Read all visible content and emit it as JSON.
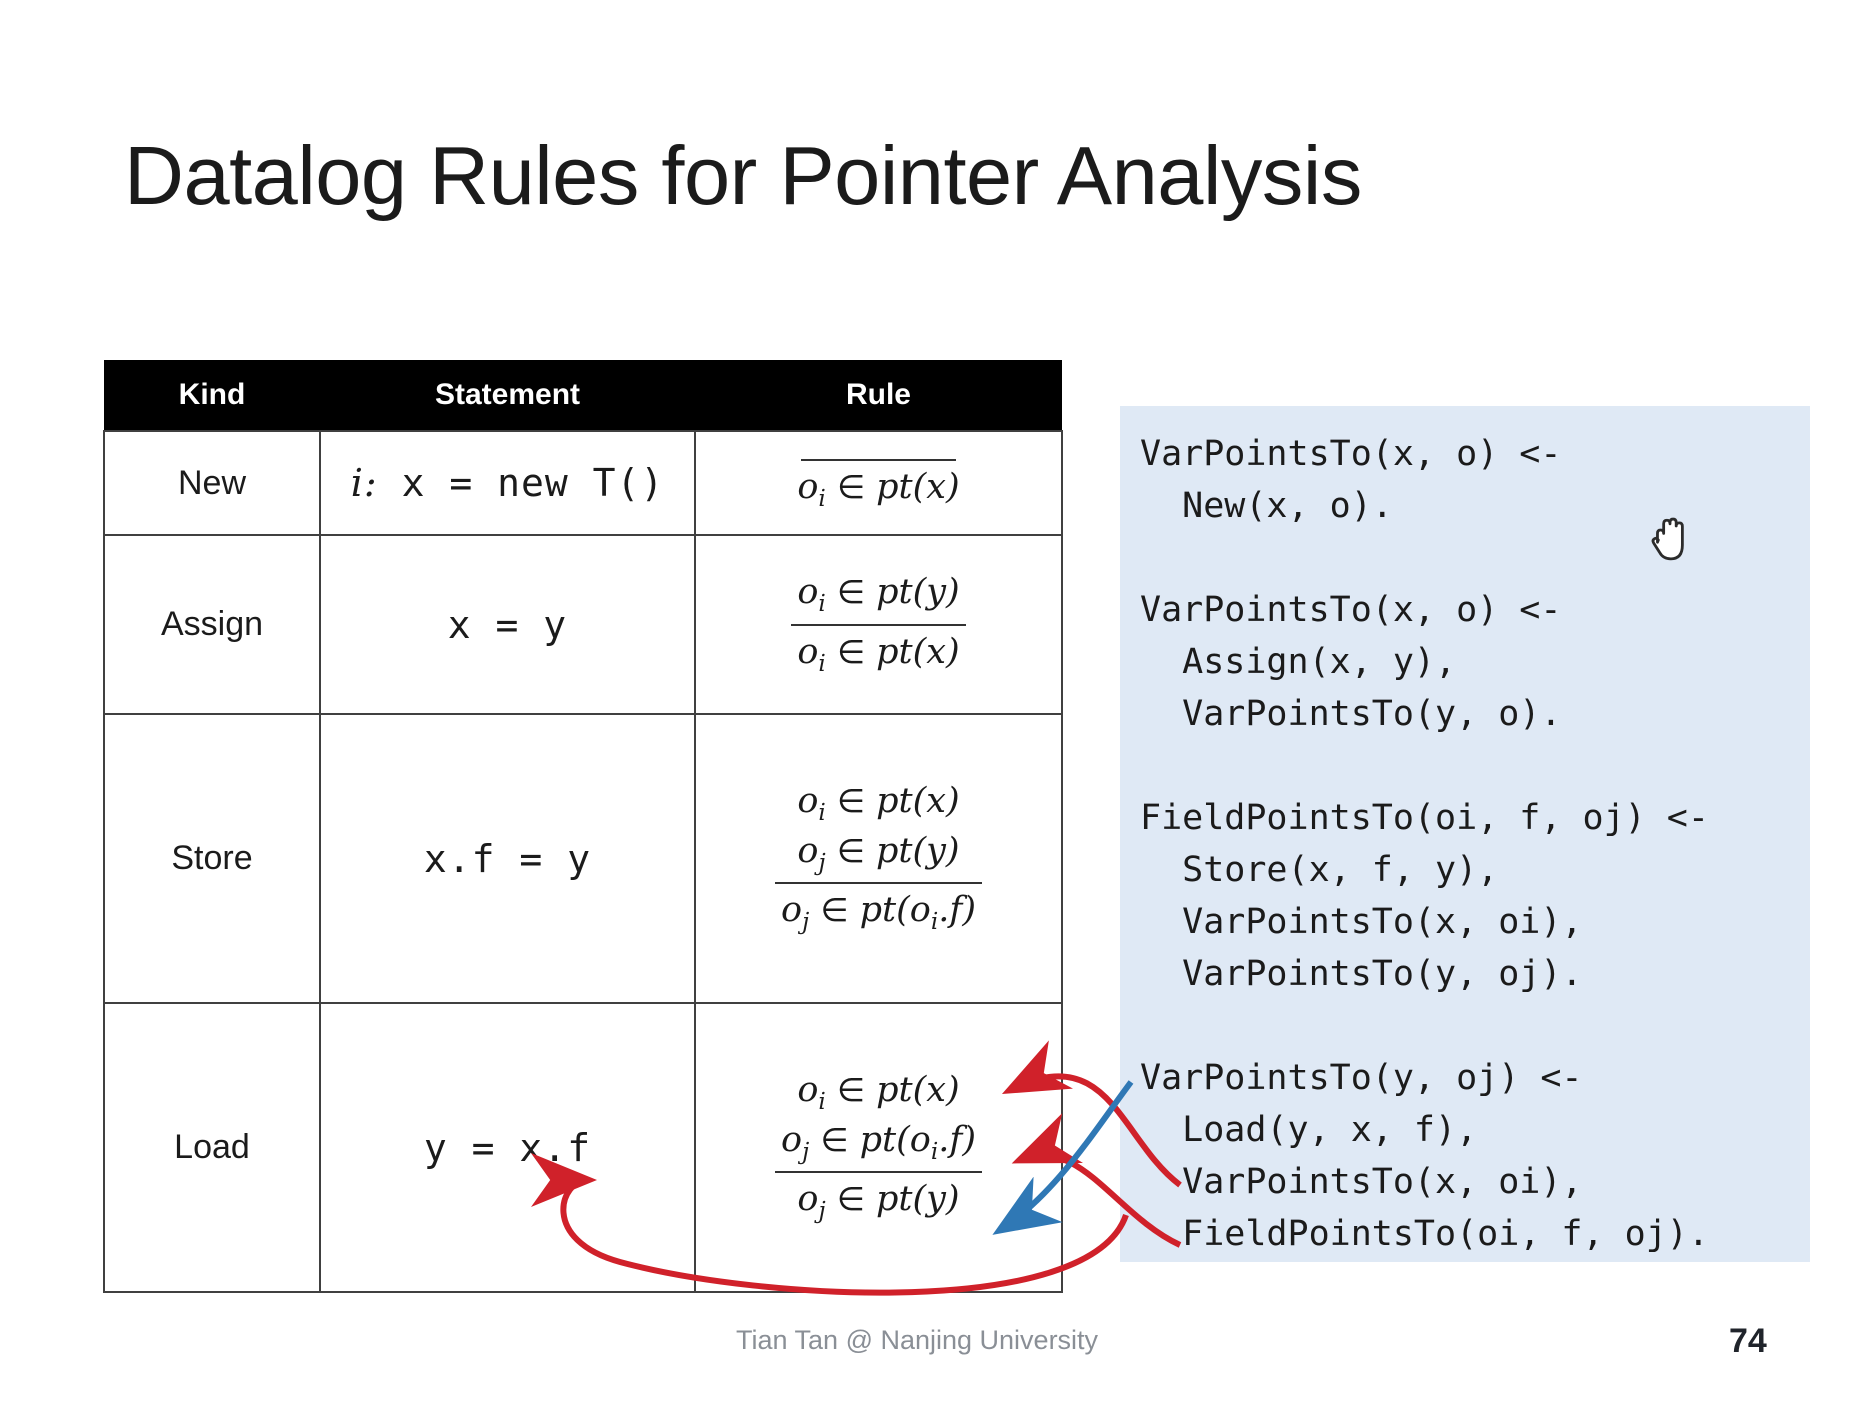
{
  "slide": {
    "title": "Datalog Rules for Pointer Analysis",
    "page_number": "74",
    "footer_credit": "Tian Tan @ Nanjing University",
    "accent_colors": {
      "code_panel_bg": "#dfe9f5",
      "header_bg": "#000000",
      "red_arrow": "#d0212a",
      "blue_arrow": "#2f78b5",
      "footer_text": "#8a8f96"
    }
  },
  "table": {
    "headers": {
      "kind": "Kind",
      "statement": "Statement",
      "rule": "Rule"
    },
    "rows": [
      {
        "kind": "New",
        "statement_prefix": "i:",
        "statement": " x = new T()",
        "rule_premises": [],
        "rule_conclusion": "oᵢ ∈ pt(x)",
        "rule_html_premises": [],
        "rule_html_conclusion": "<i>o</i><sub>i</sub> <span class=\"op\">∈</span> <i>pt</i>(<i>x</i>)"
      },
      {
        "kind": "Assign",
        "statement_prefix": "",
        "statement": "x = y",
        "rule_premises": [
          "oᵢ ∈ pt(y)"
        ],
        "rule_conclusion": "oᵢ ∈ pt(x)",
        "rule_html_premises": [
          "<i>o</i><sub>i</sub> <span class=\"op\">∈</span> <i>pt</i>(<i>y</i>)"
        ],
        "rule_html_conclusion": "<i>o</i><sub>i</sub> <span class=\"op\">∈</span> <i>pt</i>(<i>x</i>)"
      },
      {
        "kind": "Store",
        "statement_prefix": "",
        "statement": "x.f = y",
        "rule_premises": [
          "oᵢ ∈ pt(x)",
          "oⱼ ∈ pt(y)"
        ],
        "rule_conclusion": "oⱼ ∈ pt(oᵢ.f)",
        "rule_html_premises": [
          "<i>o</i><sub>i</sub> <span class=\"op\">∈</span> <i>pt</i>(<i>x</i>)",
          "<i>o</i><sub>j</sub> <span class=\"op\">∈</span> <i>pt</i>(<i>y</i>)"
        ],
        "rule_html_conclusion": "<i>o</i><sub>j</sub> <span class=\"op\">∈</span> <i>pt</i>(<i>o</i><sub>i</sub>.<i>f</i>)"
      },
      {
        "kind": "Load",
        "statement_prefix": "",
        "statement": "y = x.f",
        "rule_premises": [
          "oᵢ ∈ pt(x)",
          "oⱼ ∈ pt(oᵢ.f)"
        ],
        "rule_conclusion": "oⱼ ∈ pt(y)",
        "rule_html_premises": [
          "<i>o</i><sub>i</sub> <span class=\"op\">∈</span> <i>pt</i>(<i>x</i>)",
          "<i>o</i><sub>j</sub> <span class=\"op\">∈</span> <i>pt</i>(<i>o</i><sub>i</sub>.<i>f</i>)"
        ],
        "rule_html_conclusion": "<i>o</i><sub>j</sub> <span class=\"op\">∈</span> <i>pt</i>(<i>y</i>)"
      }
    ]
  },
  "code_panel": {
    "text": "VarPointsTo(x, o) <-\n  New(x, o).\n\nVarPointsTo(x, o) <-\n  Assign(x, y),\n  VarPointsTo(y, o).\n\nFieldPointsTo(oi, f, oj) <-\n  Store(x, f, y),\n  VarPointsTo(x, oi),\n  VarPointsTo(y, oj).\n\nVarPointsTo(y, oj) <-\n  Load(y, x, f),\n  VarPointsTo(x, oi),\n  FieldPointsTo(oi, f, oj)."
  },
  "annotations": {
    "cursor": "grab-hand-cursor",
    "arrows": [
      {
        "name": "red-arrow-to-premise-oi-pt-x",
        "color": "#d0212a"
      },
      {
        "name": "red-arrow-to-premise-oj-pt-oi-f",
        "color": "#d0212a"
      },
      {
        "name": "red-arrow-to-statement-y-eq-x-f",
        "color": "#d0212a"
      },
      {
        "name": "blue-arrow-to-conclusion-oj-pt-y",
        "color": "#2f78b5"
      }
    ]
  }
}
